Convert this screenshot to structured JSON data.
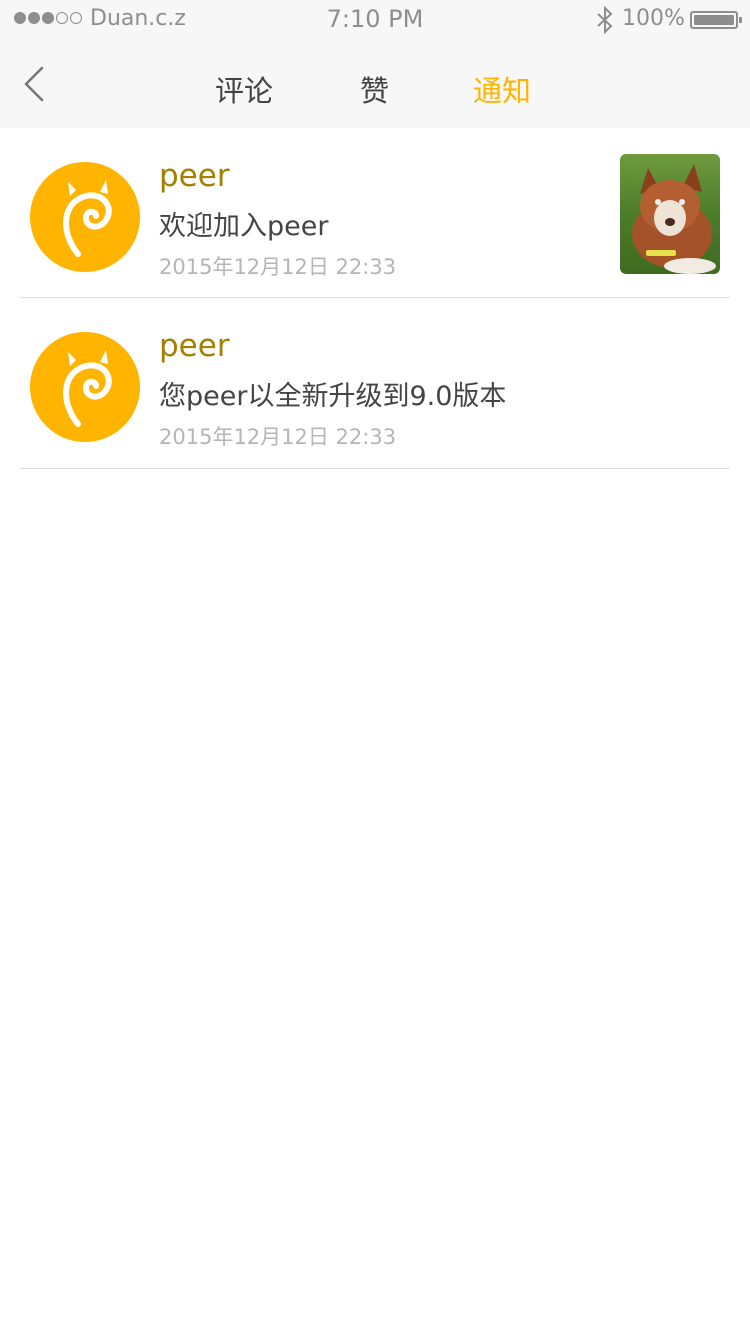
{
  "status_bar": {
    "carrier": "Duan.c.z",
    "time": "7:10 PM",
    "battery": "100%",
    "signal_bars": 3,
    "signal_total": 5,
    "battery_level": 1.0
  },
  "nav": {
    "tabs": [
      {
        "label": "评论",
        "active": false
      },
      {
        "label": "赞",
        "active": false
      },
      {
        "label": "通知",
        "active": true
      }
    ],
    "accent": "#ffb400"
  },
  "notifications": [
    {
      "name": "peer",
      "message": "欢迎加入peer",
      "date": "2015年12月12日  22:33",
      "has_thumbnail": true
    },
    {
      "name": "peer",
      "message": "您peer以全新升级到9.0版本",
      "date": "2015年12月12日  22:33",
      "has_thumbnail": false
    }
  ],
  "colors": {
    "avatar_bg": "#ffb400",
    "name": "#a57f00",
    "date": "#b5b5b5"
  }
}
